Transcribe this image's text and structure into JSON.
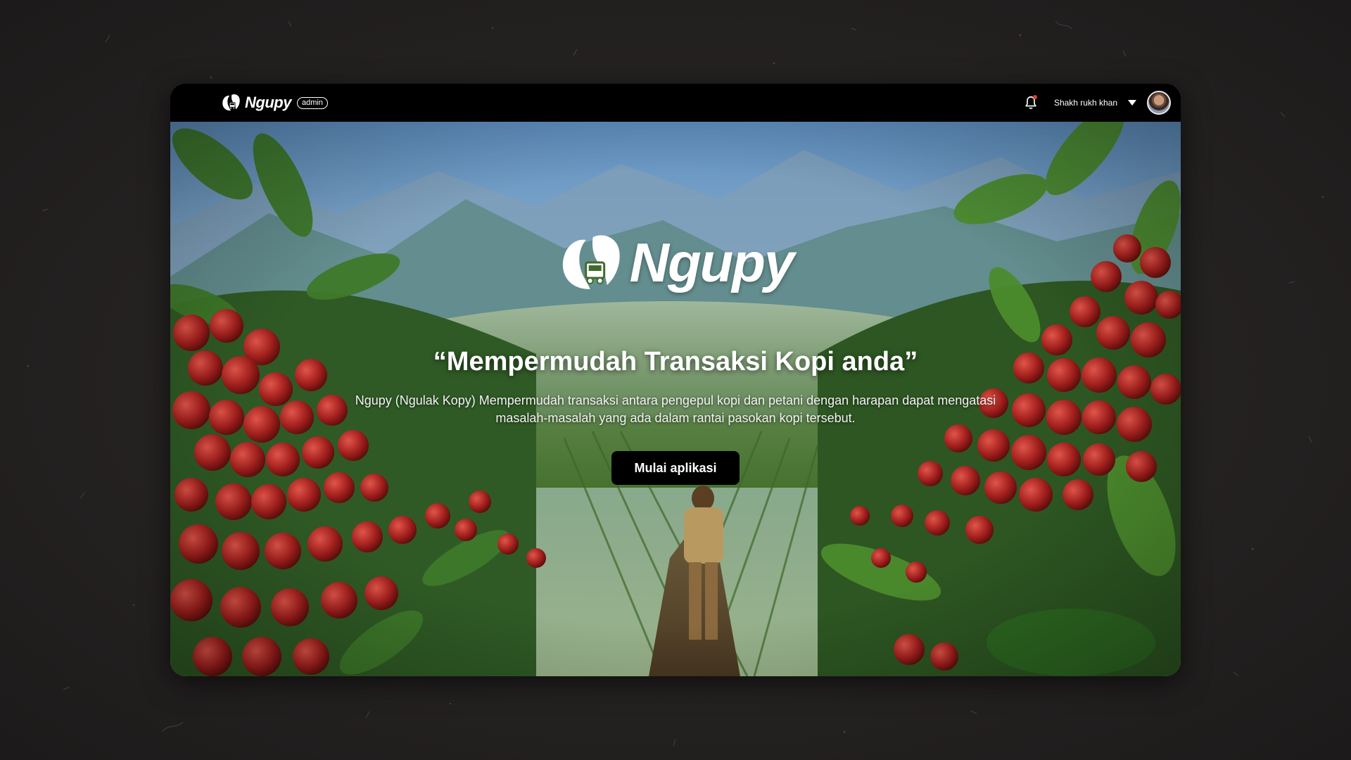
{
  "navbar": {
    "brand_name": "Ngupy",
    "role_badge": "admin",
    "user_name": "Shakh rukh khan",
    "icons": {
      "logo": "ngupy-logo-icon",
      "notification": "bell-icon",
      "dropdown": "chevron-down-icon",
      "avatar": "user-avatar"
    }
  },
  "hero": {
    "brand_name": "Ngupy",
    "tagline": "“Mempermudah Transaksi Kopi anda”",
    "description": "Ngupy (Ngulak Kopy) Mempermudah transaksi antara pengepul kopi dan petani dengan harapan dapat mengatasi masalah-masalah yang ada dalam rantai pasokan kopi tersebut.",
    "cta_label": "Mulai aplikasi",
    "background": "coffee-plantation-valley-image"
  },
  "colors": {
    "navbar_bg": "#000000",
    "button_bg": "#000000",
    "text": "#ffffff",
    "notification_dot": "#e53935",
    "backdrop": "#262222"
  }
}
